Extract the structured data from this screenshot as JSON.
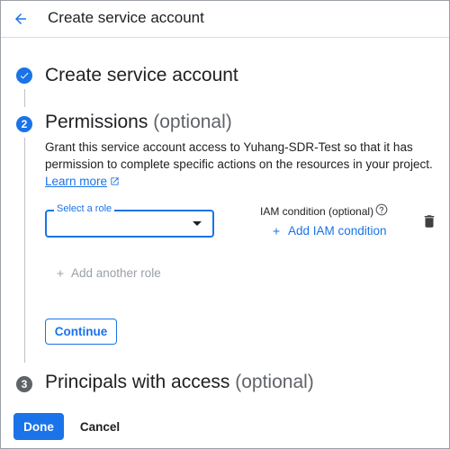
{
  "header": {
    "title": "Create service account"
  },
  "steps": [
    {
      "number": "",
      "title": "Create service account",
      "optional": "",
      "state": "done"
    },
    {
      "number": "2",
      "title": "Permissions",
      "optional": "(optional)",
      "state": "active"
    },
    {
      "number": "3",
      "title": "Principals with access",
      "optional": "(optional)",
      "state": "inactive"
    }
  ],
  "permissions": {
    "description": "Grant this service account access to Yuhang-SDR-Test so that it has permission to complete specific actions on the resources in your project.",
    "learn_more": "Learn more",
    "role_select_label": "Select a role",
    "role_select_value": "",
    "iam_condition_label": "IAM condition (optional)",
    "add_iam_condition": "Add IAM condition",
    "add_another_role": "Add another role",
    "continue_label": "Continue"
  },
  "footer": {
    "done_label": "Done",
    "cancel_label": "Cancel"
  },
  "colors": {
    "accent": "#1a73e8",
    "text": "#202124",
    "muted": "#5f6368",
    "disabled": "#9aa0a6"
  }
}
